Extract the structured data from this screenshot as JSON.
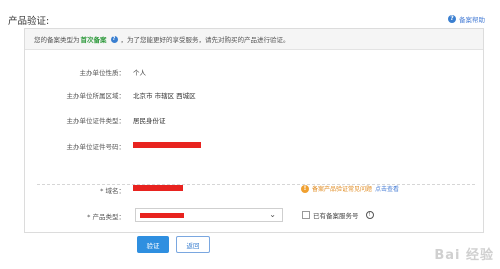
{
  "page": {
    "title": "产品验证:"
  },
  "help": {
    "label": "备案帮助"
  },
  "notice": {
    "prefix": "您的备案类型为",
    "type": "首次备案",
    "suffix": "，为了您能更好的享受服务，请先对购买的产品进行验证。"
  },
  "info": [
    {
      "label": "主办单位性质：",
      "value": "个人"
    },
    {
      "label": "主办单位所属区域：",
      "value": "北京市 市辖区 西城区"
    },
    {
      "label": "主办单位证件类型：",
      "value": "居民身份证"
    },
    {
      "label": "主办单位证件号码：",
      "value": ""
    }
  ],
  "domain": {
    "label": "* 域名："
  },
  "tip": {
    "text": "备案产品验证常见问题",
    "link": "点击查看"
  },
  "product": {
    "label": "* 产品类型：",
    "checkbox_label": "已有备案服务号"
  },
  "buttons": {
    "verify": "验证",
    "back": "返回"
  },
  "watermark": "Bai 经验",
  "colors": {
    "primary": "#2f8fe0",
    "highlight": "#2f9a3d",
    "redaction": "#e8231f",
    "warning": "#f0a030"
  }
}
